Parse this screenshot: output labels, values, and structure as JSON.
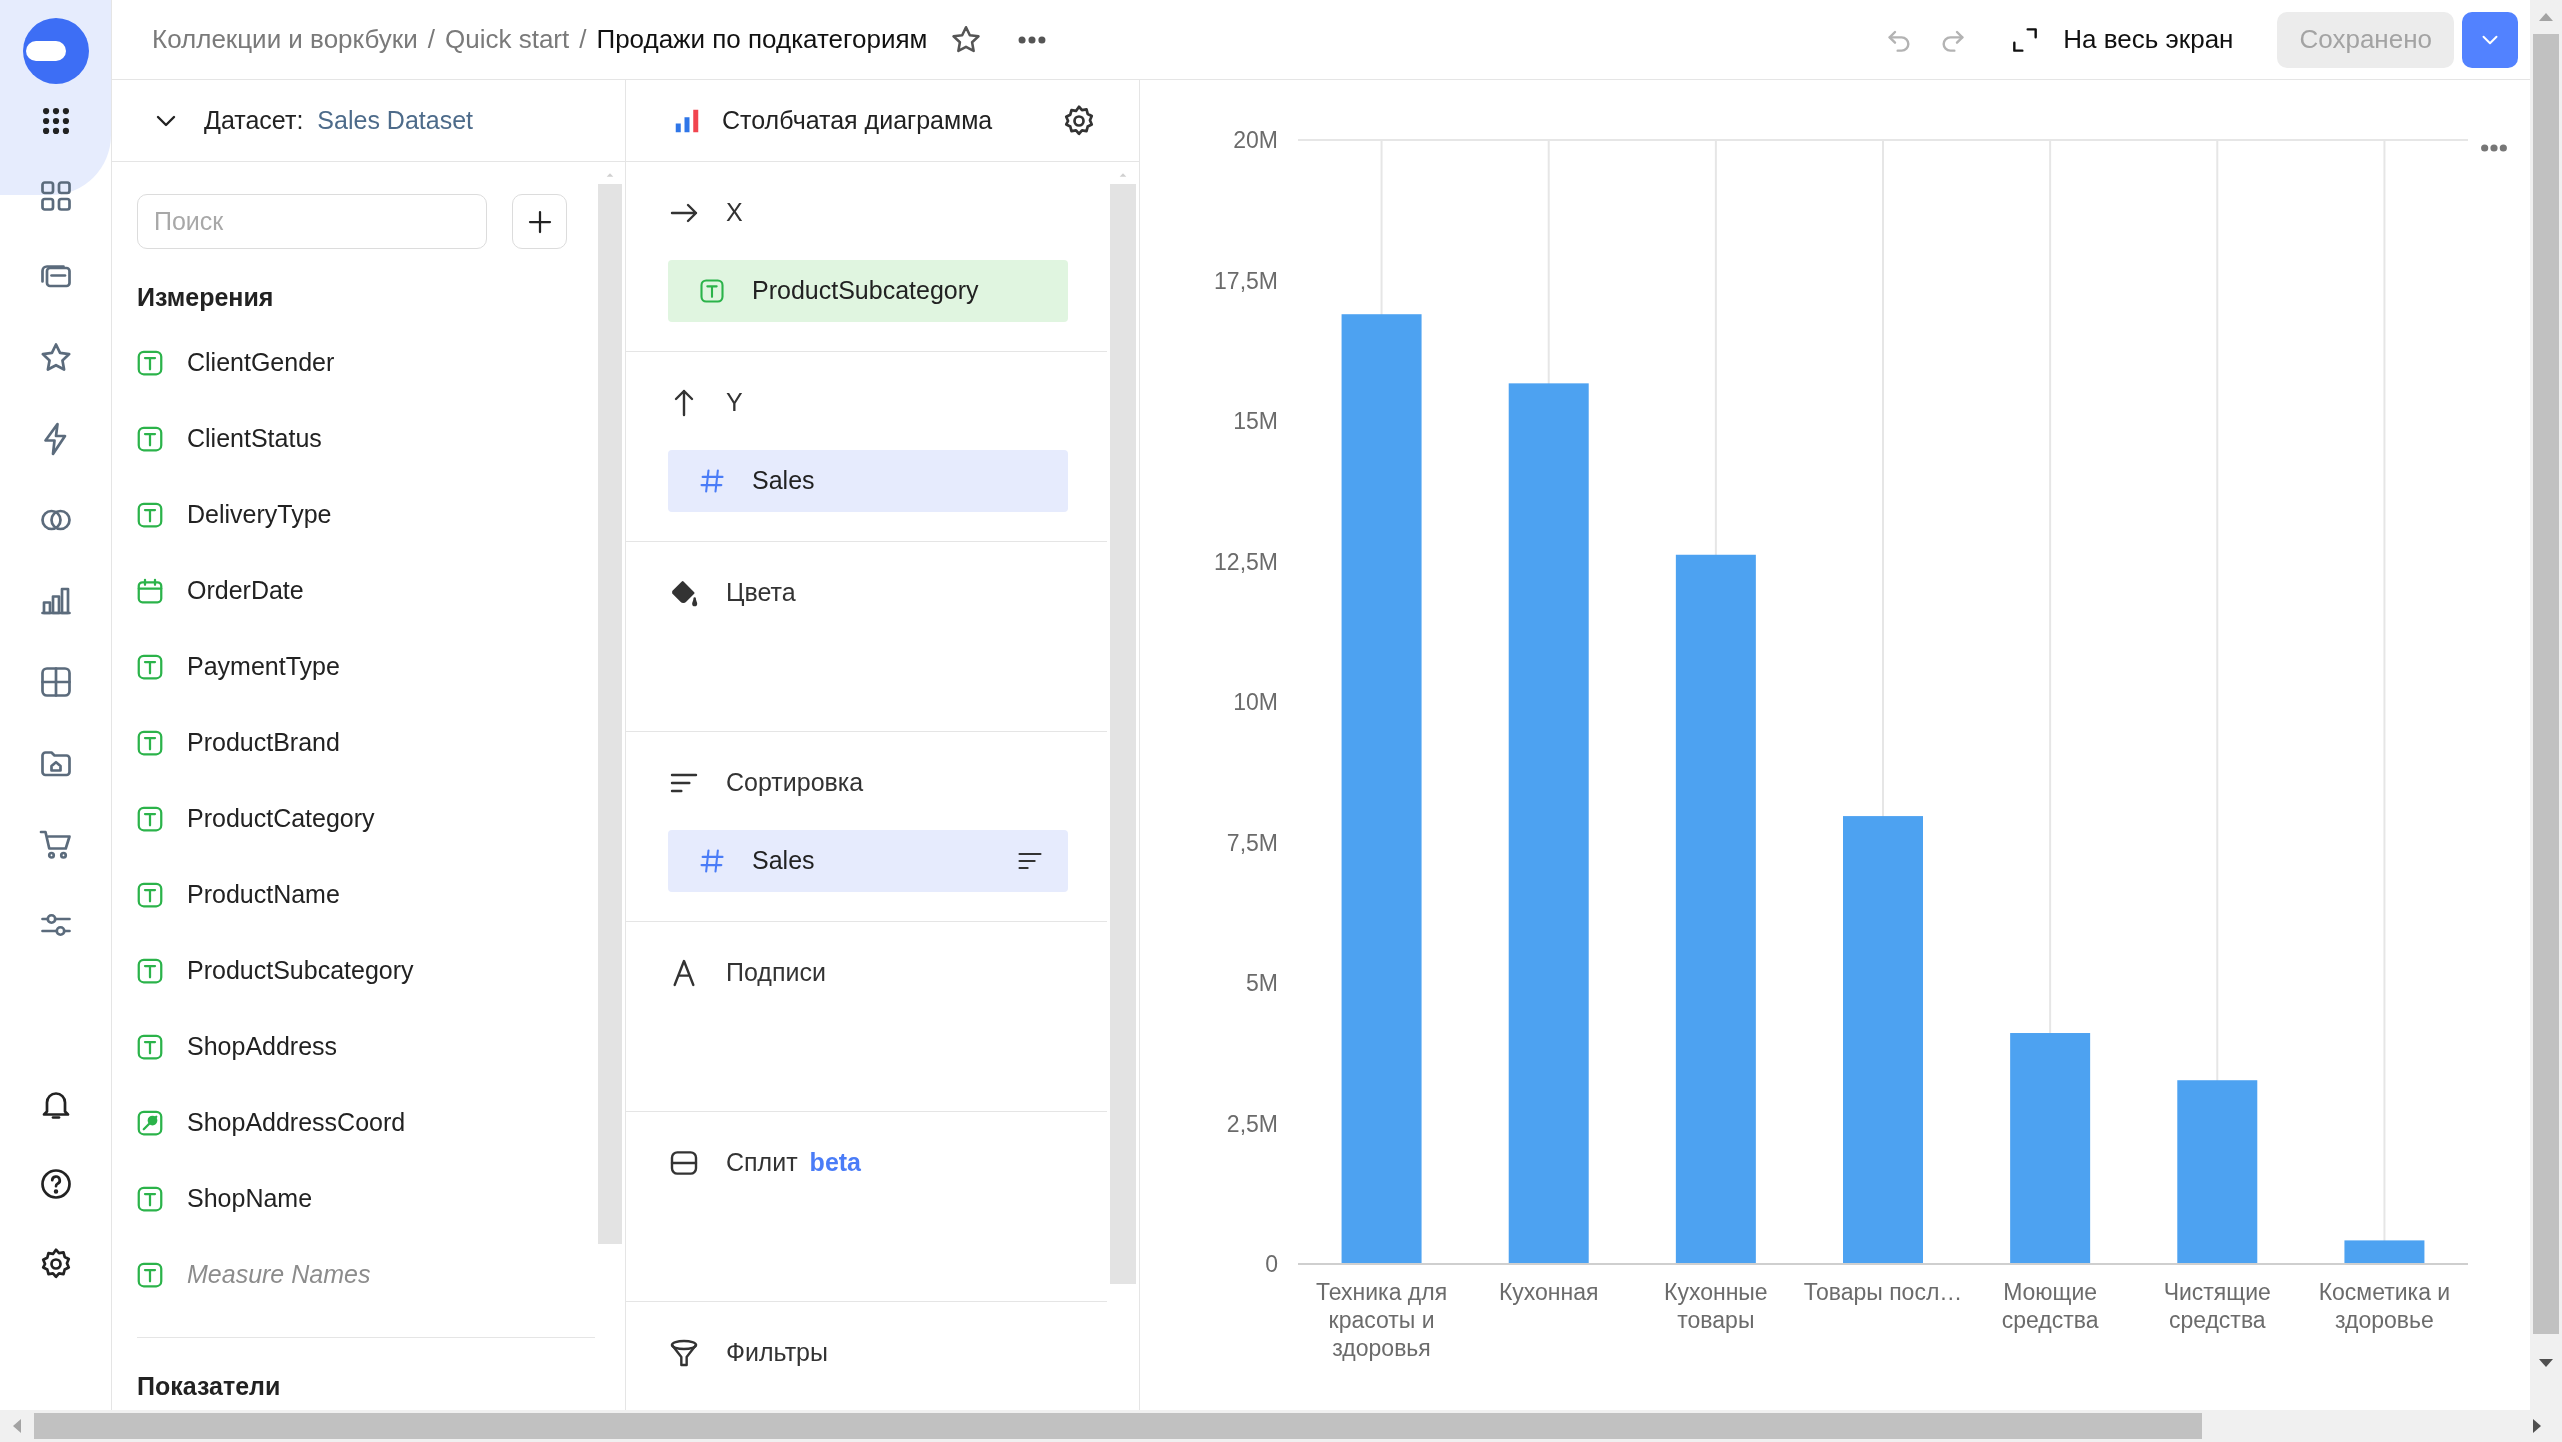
{
  "breadcrumb_separator": "/",
  "breadcrumbs": [
    {
      "label": "Коллекции и воркбуки",
      "current": false
    },
    {
      "label": "Quick start",
      "current": false
    },
    {
      "label": "Продажи по подкатегориям",
      "current": true
    }
  ],
  "toolbar": {
    "fullscreen": "На весь экран",
    "save": "Сохранено"
  },
  "dataset": {
    "label": "Датасет:",
    "name": "Sales Dataset"
  },
  "search": {
    "placeholder": "Поиск"
  },
  "dimensions": {
    "title": "Измерения",
    "items": [
      {
        "name": "ClientGender",
        "kind": "text"
      },
      {
        "name": "ClientStatus",
        "kind": "text"
      },
      {
        "name": "DeliveryType",
        "kind": "text"
      },
      {
        "name": "OrderDate",
        "kind": "date"
      },
      {
        "name": "PaymentType",
        "kind": "text"
      },
      {
        "name": "ProductBrand",
        "kind": "text"
      },
      {
        "name": "ProductCategory",
        "kind": "text"
      },
      {
        "name": "ProductName",
        "kind": "text"
      },
      {
        "name": "ProductSubcategory",
        "kind": "text"
      },
      {
        "name": "ShopAddress",
        "kind": "text"
      },
      {
        "name": "ShopAddressCoord",
        "kind": "geo"
      },
      {
        "name": "ShopName",
        "kind": "text"
      },
      {
        "name": "Measure Names",
        "kind": "pseudo"
      }
    ]
  },
  "measures": {
    "title": "Показатели"
  },
  "visualization": {
    "name": "Столбчатая диаграмма"
  },
  "sections": [
    {
      "kind": "x",
      "title": "X",
      "fields": [
        {
          "name": "ProductSubcategory",
          "kind": "dimension",
          "sort_icon": false
        }
      ]
    },
    {
      "kind": "y",
      "title": "Y",
      "fields": [
        {
          "name": "Sales",
          "kind": "measure",
          "sort_icon": false
        }
      ]
    },
    {
      "kind": "colors",
      "title": "Цвета"
    },
    {
      "kind": "sort",
      "title": "Сортировка",
      "fields": [
        {
          "name": "Sales",
          "kind": "measure",
          "sort_icon": true
        }
      ]
    },
    {
      "kind": "labels",
      "title": "Подписи"
    },
    {
      "kind": "split",
      "title": "Сплит",
      "badge": "beta"
    },
    {
      "kind": "filters",
      "title": "Фильтры"
    }
  ],
  "chart": {
    "chart_data": {
      "type": "bar",
      "categories": [
        "Техника для красоты и здоровья",
        "Кухонная",
        "Кухонные товары",
        "Товары посл…",
        "Моющие средства",
        "Чистящие средства",
        "Косметика и здоровье"
      ],
      "grid": true,
      "series": [
        {
          "color": "#4da2f1",
          "values": [
            16.9,
            15.67,
            12.62,
            7.97,
            4.11,
            3.27,
            0.42
          ]
        }
      ],
      "ylim": [
        0,
        20
      ],
      "yticks": [
        {
          "value": 0,
          "label": "0"
        },
        {
          "value": 2.5,
          "label": "2,5M"
        },
        {
          "value": 5,
          "label": "5M"
        },
        {
          "value": 7.5,
          "label": "7,5M"
        },
        {
          "value": 10,
          "label": "10M"
        },
        {
          "value": 12.5,
          "label": "12,5M"
        },
        {
          "value": 15,
          "label": "15M"
        },
        {
          "value": 17.5,
          "label": "17,5M"
        },
        {
          "value": 20,
          "label": "20M"
        }
      ]
    }
  }
}
